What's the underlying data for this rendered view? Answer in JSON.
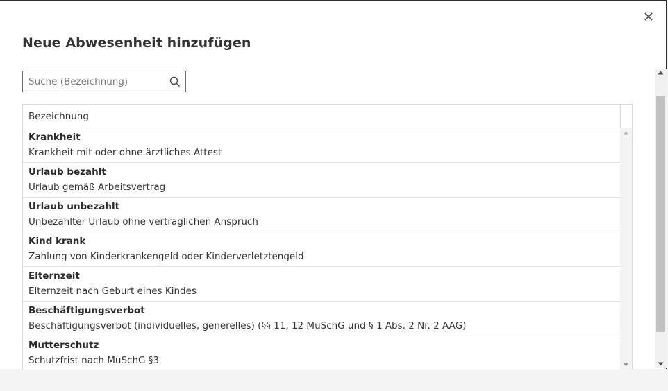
{
  "dialog": {
    "title": "Neue Abwesenheit hinzufügen",
    "close_icon": "close-icon"
  },
  "search": {
    "placeholder": "Suche (Bezeichnung)",
    "value": "",
    "icon": "search-icon"
  },
  "table": {
    "header": "Bezeichnung",
    "rows": [
      {
        "title": "Krankheit",
        "description": "Krankheit mit oder ohne ärztliches Attest"
      },
      {
        "title": "Urlaub bezahlt",
        "description": "Urlaub gemäß Arbeitsvertrag"
      },
      {
        "title": "Urlaub unbezahlt",
        "description": "Unbezahlter Urlaub ohne vertraglichen Anspruch"
      },
      {
        "title": "Kind krank",
        "description": "Zahlung von Kinderkrankengeld oder Kinderverletztengeld"
      },
      {
        "title": "Elternzeit",
        "description": "Elternzeit nach Geburt eines Kindes"
      },
      {
        "title": "Beschäftigungsverbot",
        "description": "Beschäftigungsverbot (individuelles, generelles) (§§ 11, 12 MuSchG und § 1 Abs. 2 Nr. 2 AAG)"
      },
      {
        "title": "Mutterschutz",
        "description": "Schutzfrist nach MuSchG §3"
      }
    ]
  }
}
